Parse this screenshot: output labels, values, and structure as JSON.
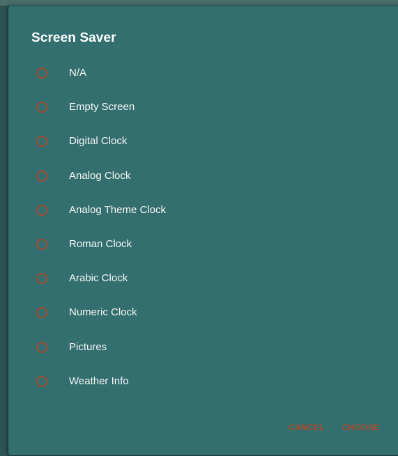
{
  "dialog": {
    "title": "Screen Saver",
    "options": [
      {
        "label": "N/A",
        "selected": false
      },
      {
        "label": "Empty Screen",
        "selected": false
      },
      {
        "label": "Digital Clock",
        "selected": false
      },
      {
        "label": "Analog Clock",
        "selected": false
      },
      {
        "label": "Analog Theme Clock",
        "selected": false
      },
      {
        "label": "Roman Clock",
        "selected": false
      },
      {
        "label": "Arabic Clock",
        "selected": false
      },
      {
        "label": "Numeric Clock",
        "selected": false
      },
      {
        "label": "Pictures",
        "selected": false
      },
      {
        "label": "Weather Info",
        "selected": false
      }
    ],
    "cancel_label": "CANCEL",
    "choose_label": "CHOOSE"
  },
  "colors": {
    "dialog_background": "#336f6e",
    "accent": "#b4482c",
    "text": "#f4f7f6"
  }
}
